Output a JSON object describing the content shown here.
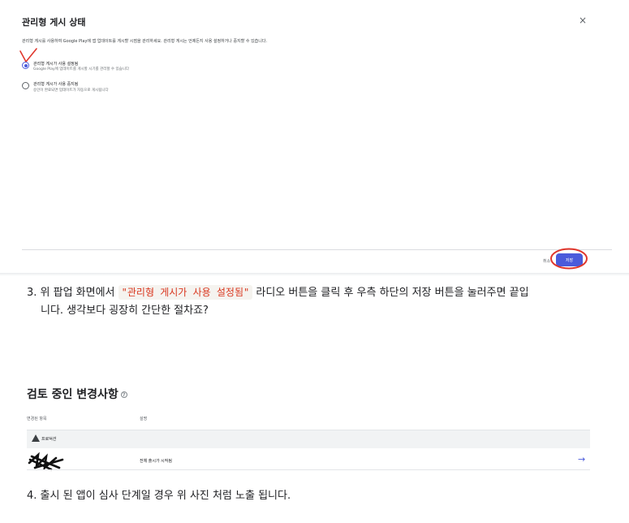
{
  "dialog": {
    "title": "관리형 게시 상태",
    "description": "관리형 게시를 사용하여 Google Play에 앱 업데이트를 게시할 시점을 관리하세요. 관리형 게시는 언제든지 사용 설정하거나 중지할 수 있습니다.",
    "options": [
      {
        "label": "관리형 게시가 사용 설정됨",
        "sublabel": "Google Play에 업데이트를 게시할 시기를 관리할 수 있습니다",
        "selected": true
      },
      {
        "label": "관리형 게시가 사용 중지됨",
        "sublabel": "승인이 완료되면 업데이트가 자동으로 게시됩니다",
        "selected": false
      }
    ],
    "cancel_label": "취소",
    "save_label": "저장",
    "close_glyph": "×",
    "accent_color": "#4b5bdb",
    "annotation_color": "#e0362c"
  },
  "step3": {
    "prefix": "3.  위 팝업 화면에서 ",
    "highlight": "\"관리형 게시가 사용 설정됨\"",
    "suffix": " 라디오 버튼을 클릭 후 우측 하단의 저장 버튼을 눌러주면 끝입",
    "line2": "니다. 생각보다 굉장히 간단한 절차죠?"
  },
  "review": {
    "title": "검토 중인 변경사항",
    "help_glyph": "?",
    "columns": [
      "변경된 항목",
      "설명"
    ],
    "group_label": "프로덕션",
    "row_description": "전체 출시가 시작됨",
    "arrow_glyph": "→"
  },
  "step4": "4.  출시 된 앱이 심사 단계일 경우 위 사진 처럼 노출 됩니다."
}
